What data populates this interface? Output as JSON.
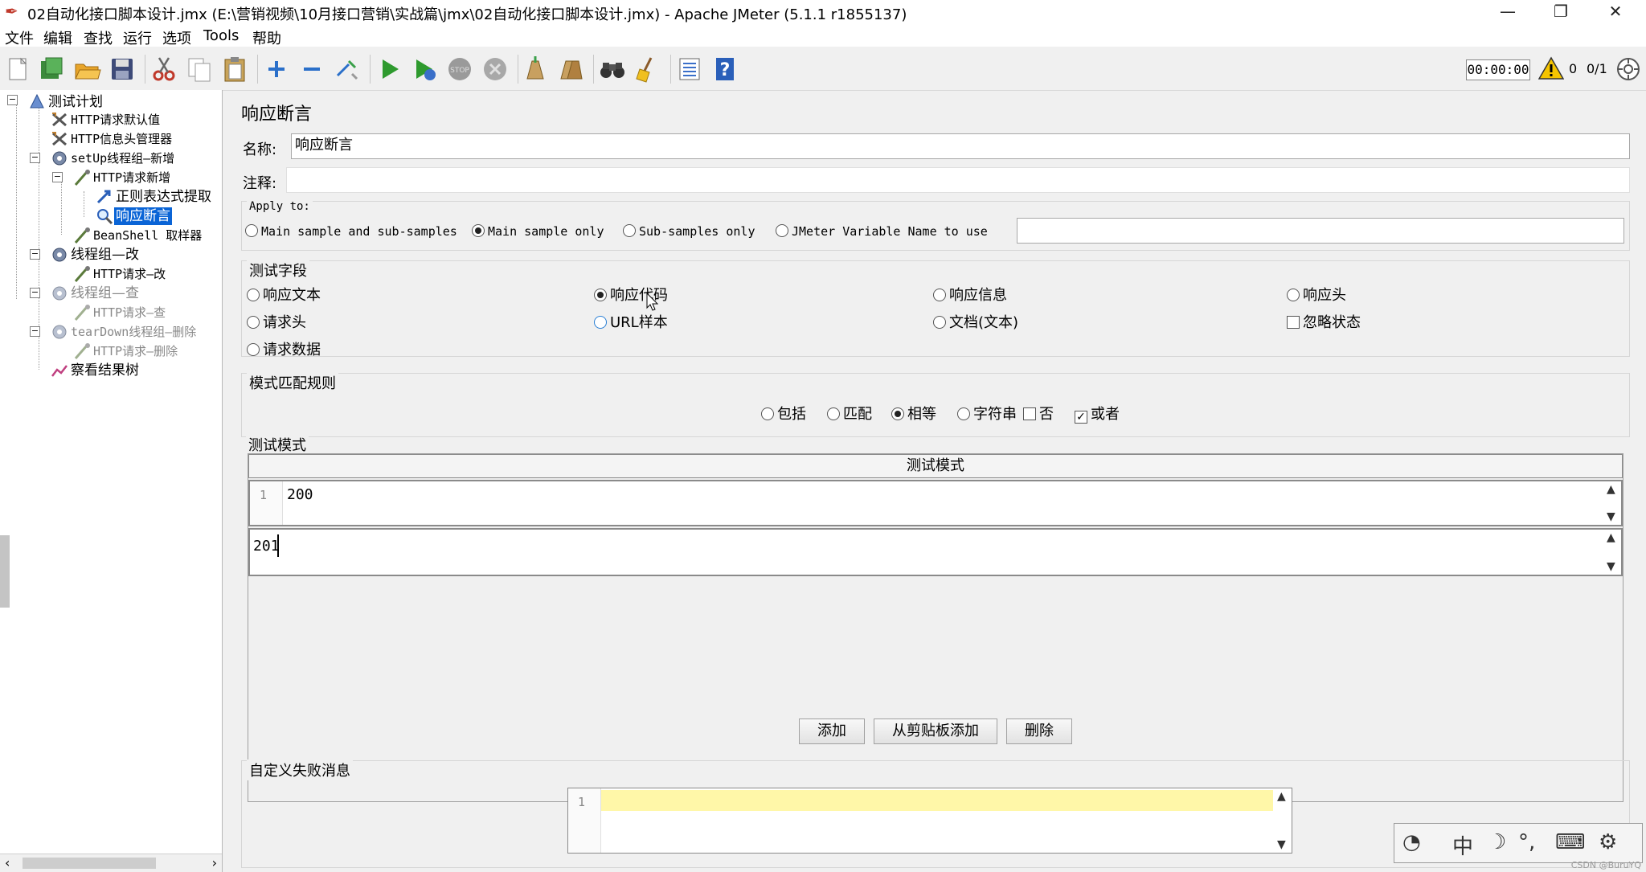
{
  "window": {
    "title": "02自动化接口脚本设计.jmx (E:\\营销视频\\10月接口营销\\实战篇\\jmx\\02自动化接口脚本设计.jmx) - Apache JMeter (5.1.1 r1855137)",
    "minimize": "—",
    "restore": "❐",
    "close": "✕"
  },
  "menu": [
    "文件",
    "编辑",
    "查找",
    "运行",
    "选项",
    "Tools",
    "帮助"
  ],
  "toolbar": {
    "timer": "00:00:00",
    "error_count": "0",
    "threads": "0/1"
  },
  "tree": [
    {
      "label": "测试计划"
    },
    {
      "label": "HTTP请求默认值"
    },
    {
      "label": "HTTP信息头管理器"
    },
    {
      "label": "setUp线程组—新增"
    },
    {
      "label": "HTTP请求新增"
    },
    {
      "label": "正则表达式提取"
    },
    {
      "label": "响应断言"
    },
    {
      "label": "BeanShell 取样器"
    },
    {
      "label": "线程组—改"
    },
    {
      "label": "HTTP请求—改"
    },
    {
      "label": "线程组—查"
    },
    {
      "label": "HTTP请求—查"
    },
    {
      "label": "tearDown线程组—删除"
    },
    {
      "label": "HTTP请求—删除"
    },
    {
      "label": "察看结果树"
    }
  ],
  "panel": {
    "title": "响应断言",
    "name_label": "名称:",
    "name_value": "响应断言",
    "comment_label": "注释:",
    "comment_value": "",
    "apply_to": {
      "title": "Apply to:",
      "options": [
        "Main sample and sub-samples",
        "Main sample only",
        "Sub-samples only",
        "JMeter Variable Name to use"
      ],
      "selected": "Main sample only",
      "variable_name": ""
    },
    "test_field": {
      "title": "测试字段",
      "options": [
        "响应文本",
        "响应代码",
        "响应信息",
        "响应头",
        "请求头",
        "URL样本",
        "文档(文本)",
        "请求数据"
      ],
      "selected": "响应代码",
      "ignore_status_label": "忽略状态",
      "ignore_status_checked": false
    },
    "pattern_rules": {
      "title": "模式匹配规则",
      "options": [
        "包括",
        "匹配",
        "相等",
        "字符串"
      ],
      "selected": "相等",
      "not_label": "否",
      "not_checked": false,
      "or_label": "或者",
      "or_checked": true
    },
    "patterns": {
      "title": "测试模式",
      "column_header": "测试模式",
      "rows": [
        {
          "line": "1",
          "value": "200"
        },
        {
          "value": "201"
        }
      ]
    },
    "buttons": {
      "add": "添加",
      "add_clipboard": "从剪贴板添加",
      "delete": "删除"
    },
    "failure_message": {
      "title": "自定义失败消息",
      "line": "1",
      "value": ""
    }
  },
  "ime": {
    "mode": "中",
    "watermark": "CSDN @BuruYQ"
  },
  "colors": {
    "selection": "#0a64d6",
    "editor_highlight": "#fff7a8",
    "panel_bg": "#f0f0f0"
  }
}
